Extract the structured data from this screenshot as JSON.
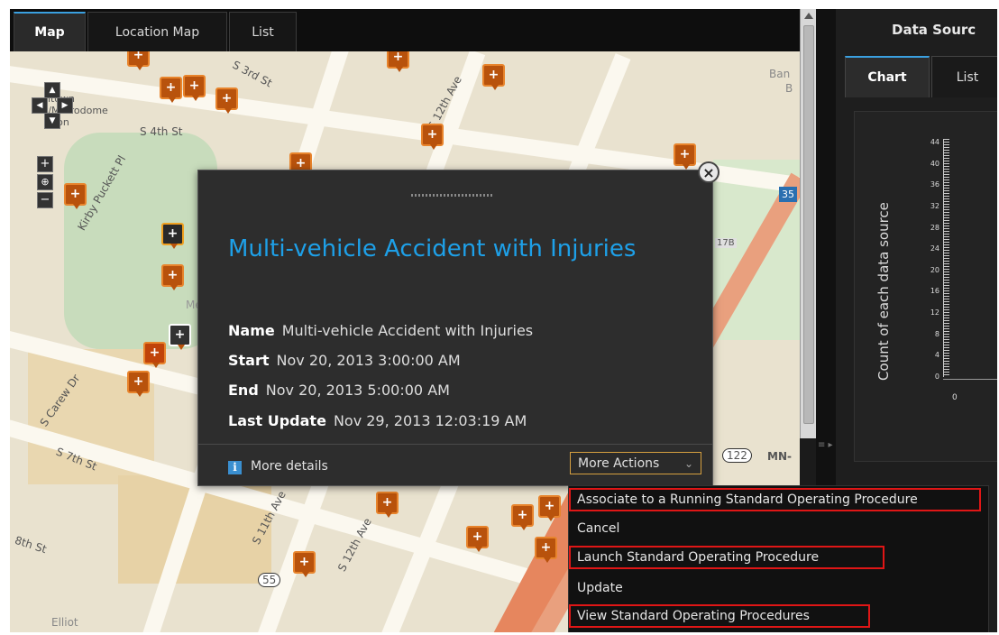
{
  "tabs": [
    "Map",
    "Location Map",
    "List"
  ],
  "map": {
    "labels": [
      "S 4th St",
      "Kirby Puckett Pl",
      "S 7th St",
      "8th St",
      "S Carew Dr",
      "S 11th Ave",
      "S 12th Ave",
      "S 3rd St",
      "S 12th Ave",
      "Elliot",
      "Me",
      "17B",
      "35",
      "122",
      "MN-",
      "55",
      "Ban",
      "B",
      "ntown",
      "t/Metrodome",
      "ation"
    ]
  },
  "popup": {
    "title": "Multi-vehicle Accident with Injuries",
    "fields": [
      {
        "label": "Name",
        "value": "Multi-vehicle Accident with Injuries"
      },
      {
        "label": "Start",
        "value": "Nov 20, 2013 3:00:00 AM"
      },
      {
        "label": "End",
        "value": "Nov 20, 2013 5:00:00 AM"
      },
      {
        "label": "Last Update",
        "value": "Nov 29, 2013 12:03:19 AM"
      }
    ],
    "more_details": "More details",
    "more_actions": "More Actions",
    "close_symbol": "×"
  },
  "menu": {
    "items": [
      {
        "label": "Associate to a Running Standard Operating Procedure",
        "highlighted": true
      },
      {
        "label": "Cancel",
        "highlighted": false
      },
      {
        "label": "Launch Standard Operating Procedure",
        "highlighted": true
      },
      {
        "label": "Update",
        "highlighted": false
      },
      {
        "label": "View Standard Operating Procedures",
        "highlighted": true
      }
    ]
  },
  "right_panel": {
    "title": "Data Sourc",
    "tabs": [
      "Chart",
      "List"
    ],
    "chart_data": {
      "type": "bar",
      "ylabel": "Count of each data source",
      "yticks": [
        0,
        4,
        8,
        12,
        16,
        20,
        24,
        28,
        32,
        36,
        40,
        44
      ],
      "xticks": [
        0
      ]
    }
  },
  "colors": {
    "accent": "#1ea0e8",
    "highlight_box": "#e01616",
    "incident_icon": "#b8520c"
  }
}
